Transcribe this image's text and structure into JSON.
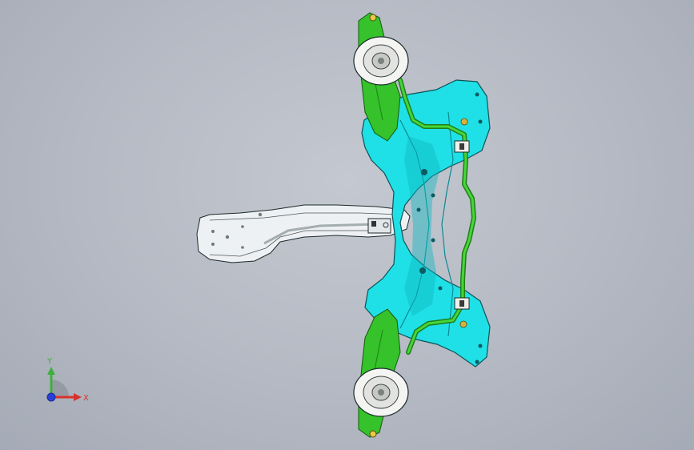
{
  "triad": {
    "y_label": "Y",
    "x_label": "X",
    "colors": {
      "y": "#3fae3f",
      "x": "#d8322e",
      "z": "#2a3fd6"
    }
  },
  "model": {
    "colors": {
      "frame": "#1fe0e6",
      "frame_dark": "#0c9aa3",
      "bracket": "#35c22a",
      "bracket_dark": "#1f7f18",
      "arm": "#eef1f4",
      "bushing": "#f4f4f2",
      "edge": "#1b2a2a"
    }
  }
}
